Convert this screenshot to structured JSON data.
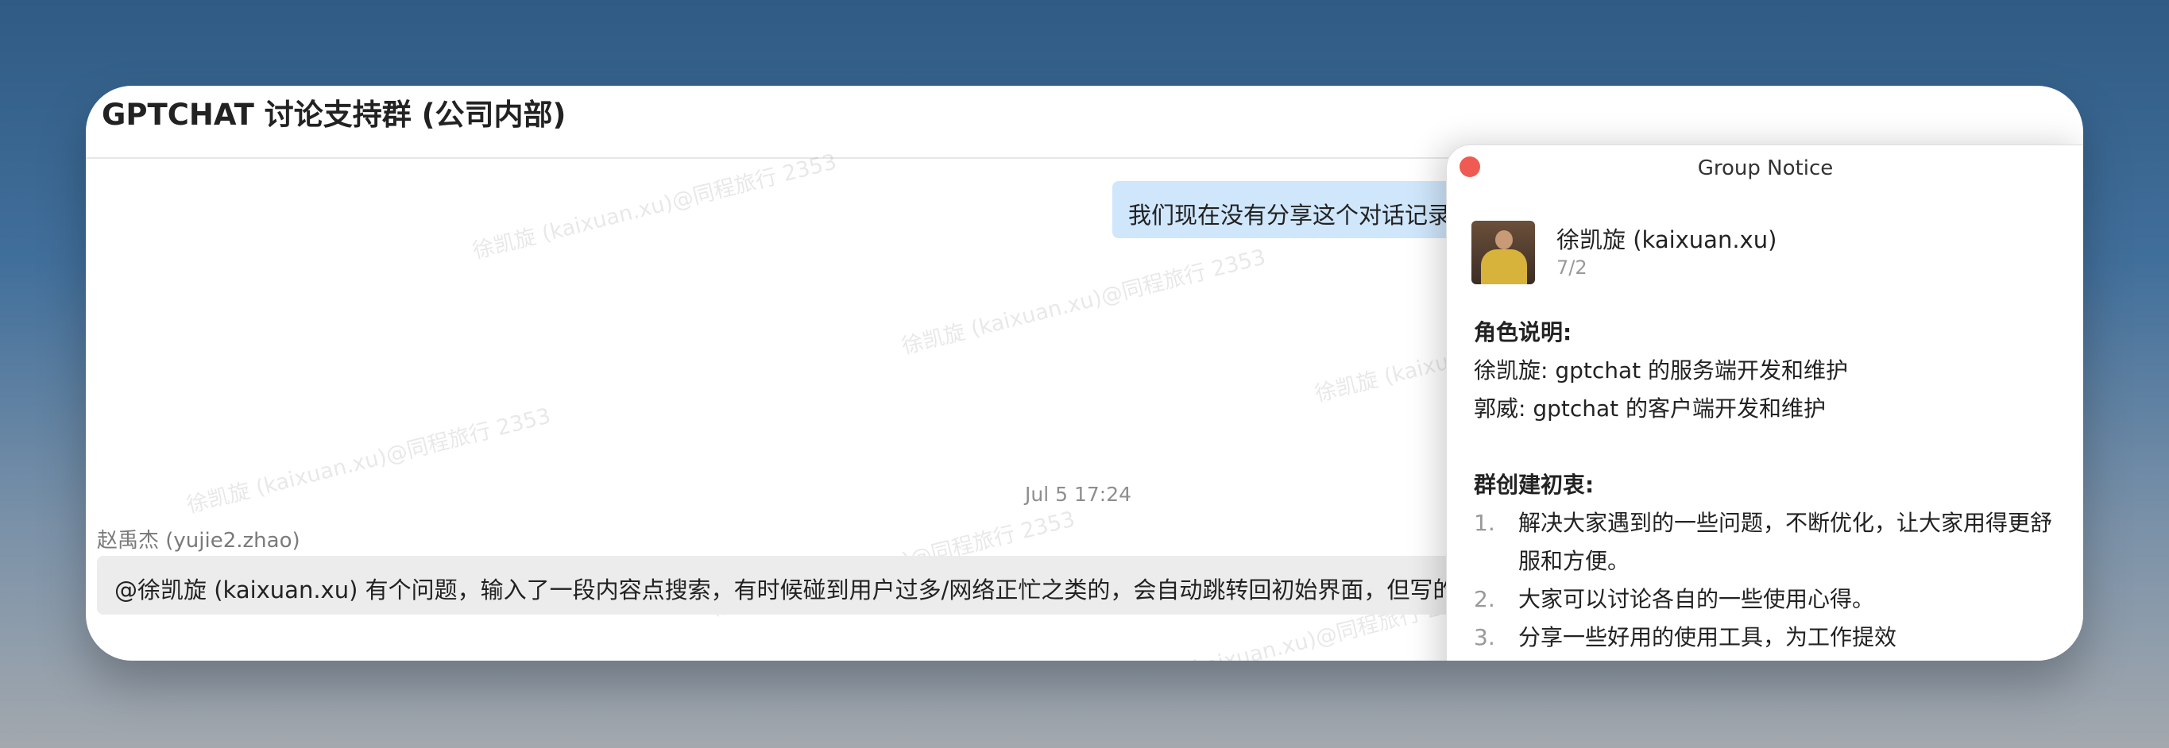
{
  "window": {
    "title": "GPTCHAT 讨论支持群 (公司内部)"
  },
  "watermark_text": "徐凯旋 (kaixuan.xu)@同程旅行 2353",
  "chat": {
    "outgoing_message": "我们现在没有分享这个对话记录",
    "timestamp": "Jul 5 17:24",
    "incoming": {
      "sender": "赵禹杰 (yujie2.zhao)",
      "message": "@徐凯旋 (kaixuan.xu) 有个问题，输入了一段内容点搜索，有时候碰到用户过多/网络正忙之类的，会自动跳转回初始界面，但写的一大"
    }
  },
  "notice": {
    "title": "Group Notice",
    "poster_name": "徐凯旋 (kaixuan.xu)",
    "poster_date": "7/2",
    "roles_heading": "角色说明:",
    "role1": "徐凯旋: gptchat 的服务端开发和维护",
    "role2": "郭威: gptchat 的客户端开发和维护",
    "purpose_heading": "群创建初衷:",
    "items": [
      {
        "num": "1.",
        "text": "解决大家遇到的一些问题，不断优化，让大家用得更舒服和方便。"
      },
      {
        "num": "2.",
        "text": "大家可以讨论各自的一些使用心得。"
      },
      {
        "num": "3.",
        "text": "分享一些好用的使用工具，为工作提效"
      }
    ]
  },
  "colors": {
    "outgoing_bubble": "#cfe6fb",
    "incoming_bubble": "#ececec",
    "close_button": "#ef5b52"
  }
}
